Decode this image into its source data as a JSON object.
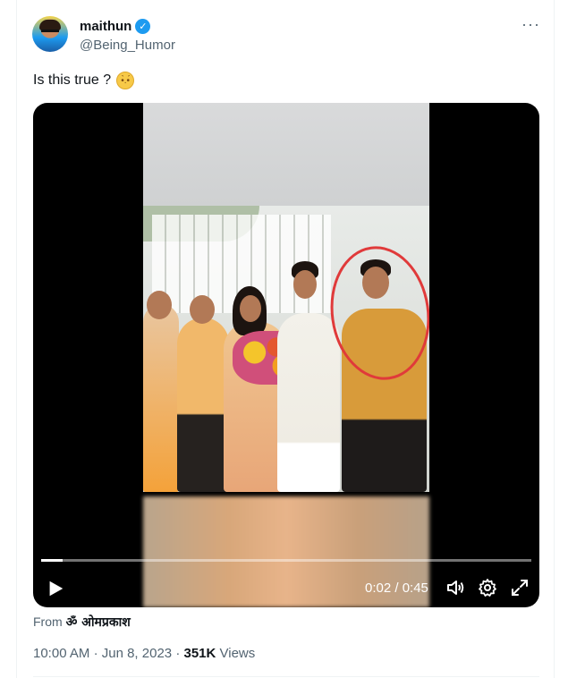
{
  "tweet": {
    "author": {
      "display_name": "maithun",
      "handle": "@Being_Humor",
      "verified_icon": "verified-badge-icon"
    },
    "more_icon": "more-horizontal-icon",
    "text": "Is this true ?",
    "emoji_icon": "thinking-face-icon"
  },
  "video": {
    "progress": 0.044,
    "current_time": "0:02",
    "separator": "/",
    "duration": "0:45",
    "time_text": "0:02 / 0:45",
    "icons": [
      "play-icon",
      "volume-icon",
      "settings-icon",
      "fullscreen-icon"
    ]
  },
  "source": {
    "prefix": "From",
    "name": "ॐ ओमप्रकाश"
  },
  "meta": {
    "time": "10:00 AM",
    "date": "Jun 8, 2023",
    "views_count": "351K",
    "views_label": "Views",
    "dot": "·"
  },
  "colors": {
    "accent": "#1d9bf0",
    "text": "#0f1419",
    "muted": "#536471",
    "highlight_circle": "#e03a3a"
  }
}
